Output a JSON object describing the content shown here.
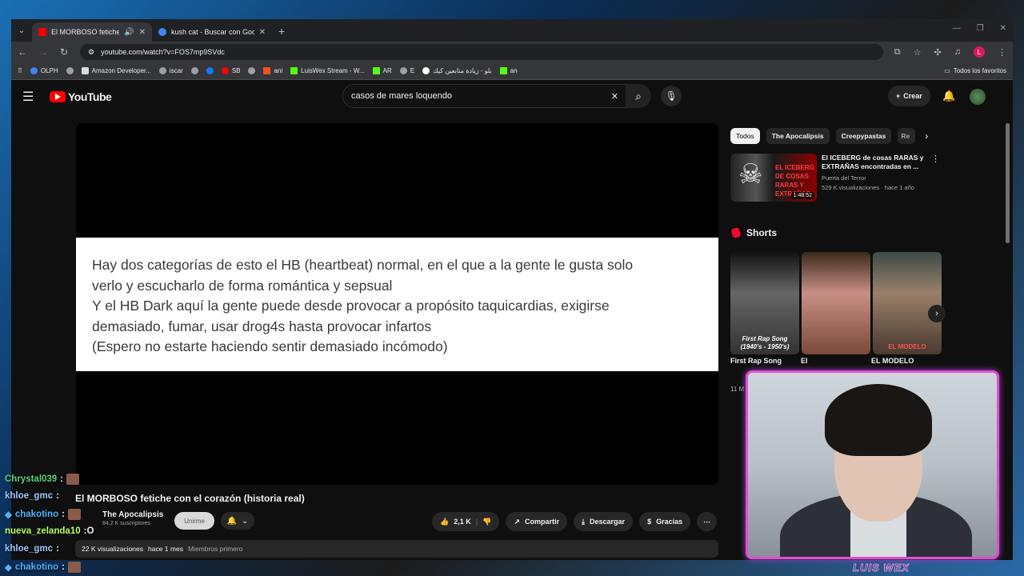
{
  "browser": {
    "tabs": [
      {
        "title": "El MORBOSO fetiche con el c",
        "active": true
      },
      {
        "title": "kush cat - Buscar con Google",
        "active": false
      }
    ],
    "url": "youtube.com/watch?v=FOS7mp9SVdc",
    "bookmarks": [
      "OLPH",
      "Amazon Developer...",
      "iscar",
      "SB",
      "ani",
      "LuisWex Stream - W...",
      "AR",
      "E",
      "بلو - زيادة متابعين كيك",
      "an"
    ],
    "all_bookmarks": "Todos los favoritos"
  },
  "youtube": {
    "logo": "YouTube",
    "search_query": "casos de mares loquendo",
    "create_label": "Crear"
  },
  "video": {
    "slide_lines": [
      "Hay dos categorías de esto el HB (heartbeat) normal, en el que a la gente le gusta solo",
      "verlo y escucharlo de forma romántica y sepsual",
      "Y el HB Dark aquí la gente puede desde provocar a propósito taquicardias, exigirse",
      "demasiado, fumar, usar drog4s hasta provocar infartos",
      "(Espero no estarte haciendo sentir demasiado incómodo)"
    ],
    "title": "El MORBOSO fetiche con el corazón (historia real)",
    "channel": "The Apocalipsis",
    "subscribers": "84,2 K suscriptores",
    "join_label": "Unirme",
    "likes": "2,1 K",
    "share_label": "Compartir",
    "download_label": "Descargar",
    "thanks_label": "Gracias",
    "views": "22 K visualizaciones",
    "date": "hace 1 mes",
    "members": "Miembros primero"
  },
  "sidebar": {
    "chips": [
      "Todos",
      "The Apocalipsis",
      "Creepypastas",
      "Re"
    ],
    "recommendation": {
      "title": "El ICEBERG de cosas RARAS y EXTRAÑAS encontradas en ...",
      "channel": "Puerta del Terror",
      "meta": "529 K visualizaciones · hace 1 año",
      "duration": "1:48:52",
      "thumb_text": "EL ICEBERG DE COSAS RARAS Y EXTRAÑAS"
    },
    "shorts_heading": "Shorts",
    "shorts": [
      {
        "caption": "First Rap Song (1940's - 1950's)",
        "title": "First Rap Song"
      },
      {
        "caption": "",
        "title": "El"
      },
      {
        "caption": "EL MODELO",
        "title": "EL MODELO"
      }
    ],
    "shorts_meta": "11 M"
  },
  "chat": [
    {
      "user": "Chrystal039",
      "color": "#5fd17a",
      "msg": ""
    },
    {
      "user": "khloe_gmc",
      "color": "#9ec5ff",
      "msg": ""
    },
    {
      "user": "chakotino",
      "color": "#4fb3ff",
      "msg": ""
    },
    {
      "user": "nueva_zelanda10",
      "color": "#b8ff6b",
      "msg": ":O"
    },
    {
      "user": "khloe_gmc",
      "color": "#9ec5ff",
      "msg": ""
    },
    {
      "user": "chakotino",
      "color": "#4fb3ff",
      "msg": ""
    }
  ],
  "streamer": {
    "name": "LUIS WEX"
  }
}
